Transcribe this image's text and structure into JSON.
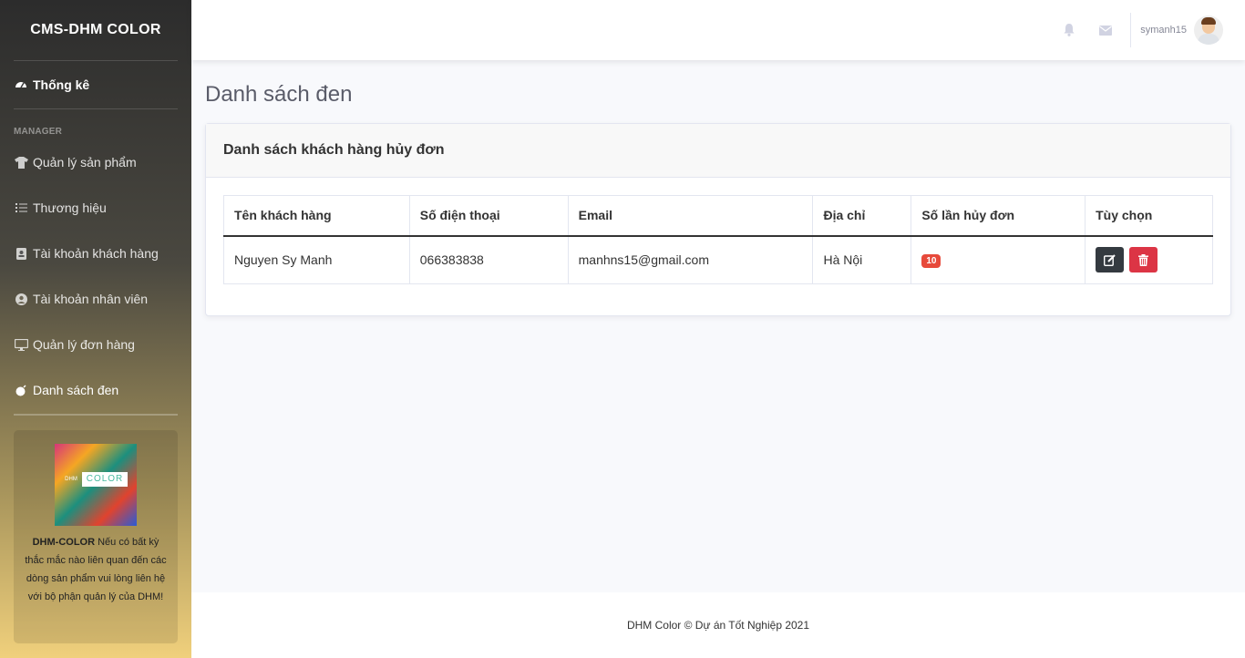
{
  "sidebar": {
    "brand": "CMS-DHM COLOR",
    "dashboard": {
      "label": "Thống kê",
      "icon": "tachometer-icon"
    },
    "heading": "MANAGER",
    "items": [
      {
        "label": "Quản lý sản phẩm",
        "icon": "tshirt-icon"
      },
      {
        "label": "Thương hiệu",
        "icon": "list-icon"
      },
      {
        "label": "Tài khoản khách hàng",
        "icon": "id-card-icon"
      },
      {
        "label": "Tài khoản nhân viên",
        "icon": "user-circle-icon"
      },
      {
        "label": "Quản lý đơn hàng",
        "icon": "desktop-icon"
      },
      {
        "label": "Danh sách đen",
        "icon": "bomb-icon"
      }
    ],
    "card": {
      "logo_text": "COLOR",
      "logo_prefix": "DHM",
      "brand": "DHM-COLOR",
      "text": " Nếu có bất kỳ thắc mắc nào liên quan đến các dòng sản phẩm vui lòng liên hệ với bộ phận quản lý của DHM!"
    }
  },
  "topbar": {
    "username": "symanh15",
    "icons": [
      "bell-icon",
      "envelope-icon"
    ]
  },
  "page": {
    "title": "Danh sách đen",
    "card_title": "Danh sách khách hàng hủy đơn"
  },
  "table": {
    "headers": [
      "Tên khách hàng",
      "Số điện thoại",
      "Email",
      "Địa chỉ",
      "Số lần hủy đơn",
      "Tùy chọn"
    ],
    "rows": [
      {
        "name": "Nguyen Sy Manh",
        "phone": "066383838",
        "email": "manhns15@gmail.com",
        "address": "Hà Nội",
        "cancel_count": "10"
      }
    ]
  },
  "footer": {
    "text": "DHM Color © Dự án Tốt Nghiệp 2021"
  },
  "colors": {
    "accent_danger": "#e74a3b",
    "edit_button": "#343a40",
    "delete_button": "#dc3545"
  }
}
